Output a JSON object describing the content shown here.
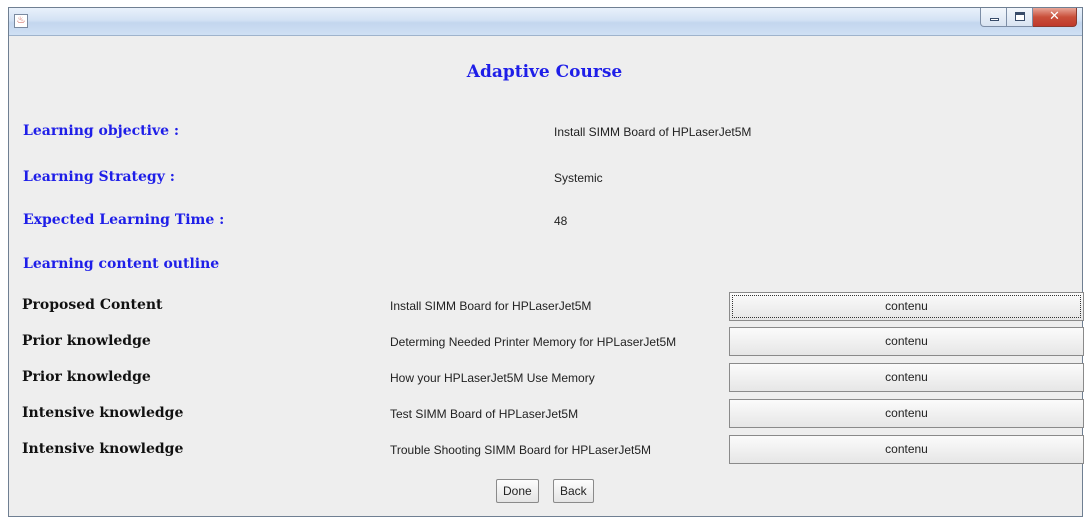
{
  "window": {
    "app_icon": "java-cup-icon",
    "controls": {
      "minimize": "minimize-icon",
      "maximize": "maximize-icon",
      "close": "close-icon"
    }
  },
  "title": "Adaptive Course",
  "fields": {
    "objective": {
      "label": "Learning objective :",
      "value": "Install SIMM Board of HPLaserJet5M"
    },
    "strategy": {
      "label": "Learning Strategy :",
      "value": "Systemic"
    },
    "time": {
      "label": "Expected Learning Time :",
      "value": "48"
    }
  },
  "outline_heading": "Learning content outline",
  "rows": [
    {
      "label": "Proposed Content",
      "text": "Install SIMM Board for HPLaserJet5M",
      "button": "contenu"
    },
    {
      "label": "Prior knowledge",
      "text": "Determing Needed Printer Memory for HPLaserJet5M",
      "button": "contenu"
    },
    {
      "label": "Prior knowledge",
      "text": "How your HPLaserJet5M Use Memory",
      "button": "contenu"
    },
    {
      "label": "Intensive knowledge",
      "text": "Test SIMM Board of HPLaserJet5M",
      "button": "contenu"
    },
    {
      "label": "Intensive knowledge",
      "text": "Trouble Shooting SIMM Board for HPLaserJet5M",
      "button": "contenu"
    }
  ],
  "actions": {
    "done": "Done",
    "back": "Back"
  },
  "colors": {
    "label_blue": "#1e1ee8",
    "background": "#eeeeee"
  }
}
